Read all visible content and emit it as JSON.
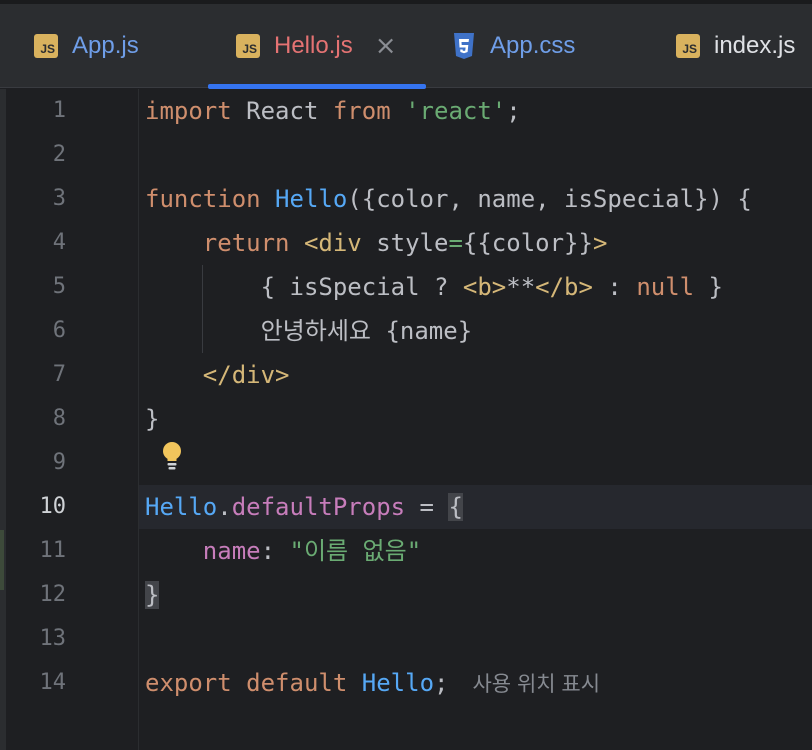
{
  "tabs": [
    {
      "icon": "js",
      "label": "App.js",
      "active": false
    },
    {
      "icon": "js",
      "label": "Hello.js",
      "active": true,
      "close": "×"
    },
    {
      "icon": "css",
      "label": "App.css",
      "active": false
    },
    {
      "icon": "js",
      "label": "index.js",
      "active": false
    }
  ],
  "js_icon_text": "JS",
  "line_numbers": [
    "1",
    "2",
    "3",
    "4",
    "5",
    "6",
    "7",
    "8",
    "9",
    "10",
    "11",
    "12",
    "13",
    "14"
  ],
  "current_line": "10",
  "code": {
    "l1": {
      "kw_import": "import",
      "t1": " React ",
      "kw_from": "from",
      "t2": " ",
      "str": "'react'",
      "t3": ";"
    },
    "l3": {
      "kw": "function",
      "t1": " ",
      "fn": "Hello",
      "t2": "({color, name, isSpecial}) {"
    },
    "l4": {
      "indent": "    ",
      "kw": "return",
      "t1": " ",
      "tag_open": "<div",
      "t2": " style",
      "eq": "=",
      "t3": "{{color}}",
      "tag_close": ">"
    },
    "l5": {
      "indent": "        ",
      "t1": "{ isSpecial ? ",
      "b_open": "<b>",
      "t2": "**",
      "b_close": "</b>",
      "t3": " : ",
      "kw_null": "null",
      "t4": " }"
    },
    "l6": {
      "indent": "        ",
      "t1": "안녕하세요 {name}"
    },
    "l7": {
      "indent": "    ",
      "tag": "</div>"
    },
    "l8": {
      "t1": "}"
    },
    "l10": {
      "fn": "Hello",
      "dot": ".",
      "prop": "defaultProps",
      "t1": " = ",
      "brace": "{"
    },
    "l11": {
      "indent": "    ",
      "prop": "name",
      "t1": ": ",
      "str": "\"이름 없음\""
    },
    "l12": {
      "brace": "}"
    },
    "l14": {
      "kw_export": "export",
      "t1": " ",
      "kw_default": "default",
      "t2": " ",
      "fn": "Hello",
      "t3": ";",
      "hint": "사용 위치 표시"
    }
  },
  "colors": {
    "keyword": "#cf8e6d",
    "string": "#6aab73",
    "function": "#56a8f5",
    "property": "#c77dbb",
    "tag": "#d5b778",
    "accent": "#3574f0"
  }
}
